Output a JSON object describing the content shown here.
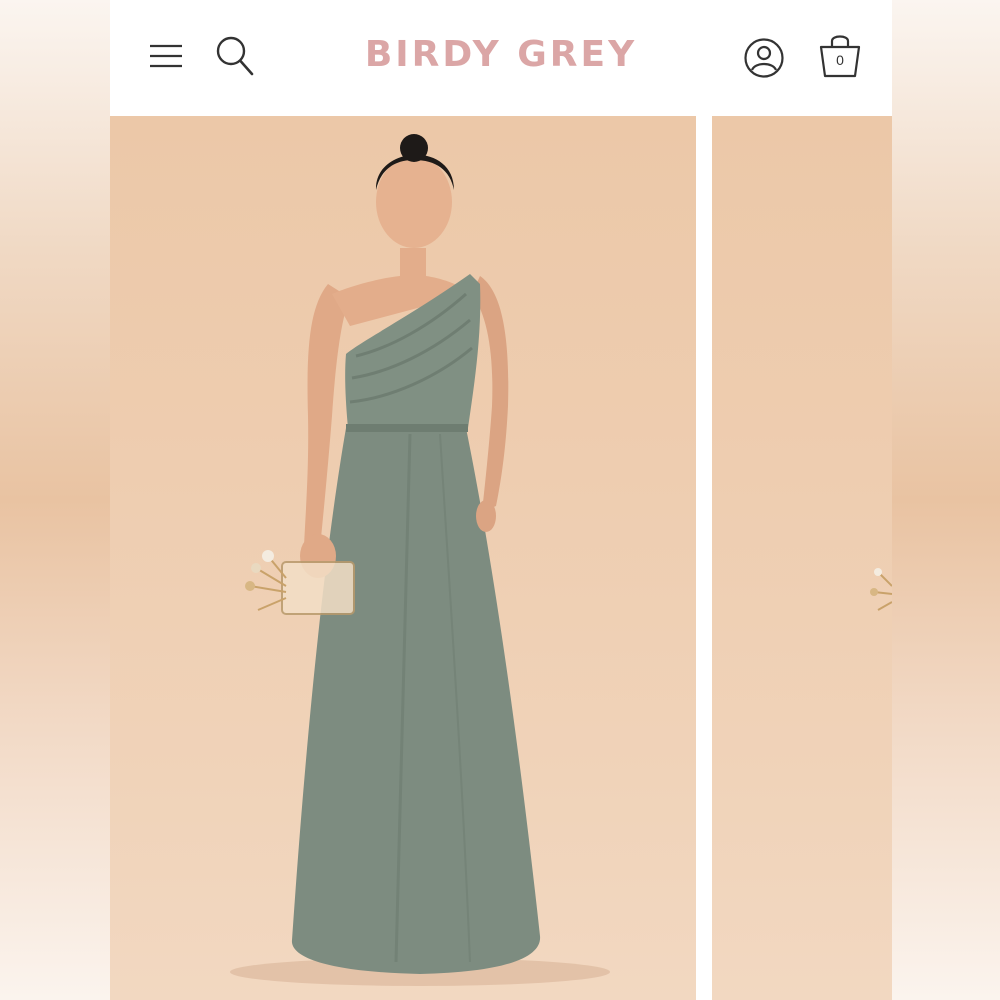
{
  "header": {
    "brand": "BIRDY GREY",
    "cart_count": "0",
    "icons": {
      "menu": "hamburger-menu-icon",
      "search": "search-icon",
      "account": "user-account-icon",
      "cart": "shopping-bag-icon"
    }
  },
  "gallery": {
    "images": [
      {
        "subject": "model-in-sage-one-shoulder-gown"
      },
      {
        "subject": "next-product-image-partial"
      }
    ]
  },
  "colors": {
    "brand": "#dba6a6",
    "backdrop": "#ecc8a8",
    "dress": "#7d8c80",
    "icons": "#333333"
  }
}
